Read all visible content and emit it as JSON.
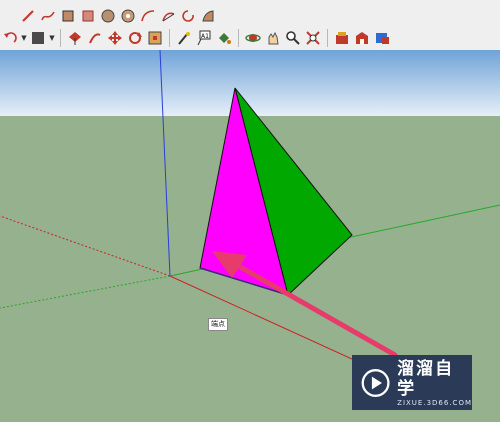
{
  "toolbar": {
    "row1": [
      "pencil-tool",
      "freehand-tool",
      "rectangle-tool",
      "rotated-rectangle-tool",
      "circle-tool",
      "polygon-tool",
      "arc-tool",
      "pie-tool",
      "two-point-arc-tool",
      "three-point-arc-tool"
    ],
    "row2": [
      "eraser-tool",
      "paint-bucket-tool",
      "push-pull-tool",
      "move-tool",
      "rotate-tool",
      "scale-tool",
      "offset-tool",
      "tape-measure-tool",
      "text-tool",
      "axes-tool",
      "dimension-tool",
      "orbit-tool",
      "pan-tool",
      "zoom-tool",
      "zoom-extents-tool",
      "components-tool",
      "3d-warehouse-tool",
      "extension-tool"
    ]
  },
  "viewport": {
    "sky_color": "#a9c8e4",
    "ground_color": "#95b18e",
    "pyramid_left_face_color": "#ff00ff",
    "pyramid_right_face_color": "#00a800",
    "axis_blue": "#2b3fd6",
    "axis_red": "#cc2222",
    "axis_green": "#22aa22",
    "arrow_color": "#e63b6b",
    "edge_tooltip": "端点"
  },
  "watermark": {
    "title": "溜溜自学",
    "subtitle": "ZIXUE.3D66.COM"
  }
}
